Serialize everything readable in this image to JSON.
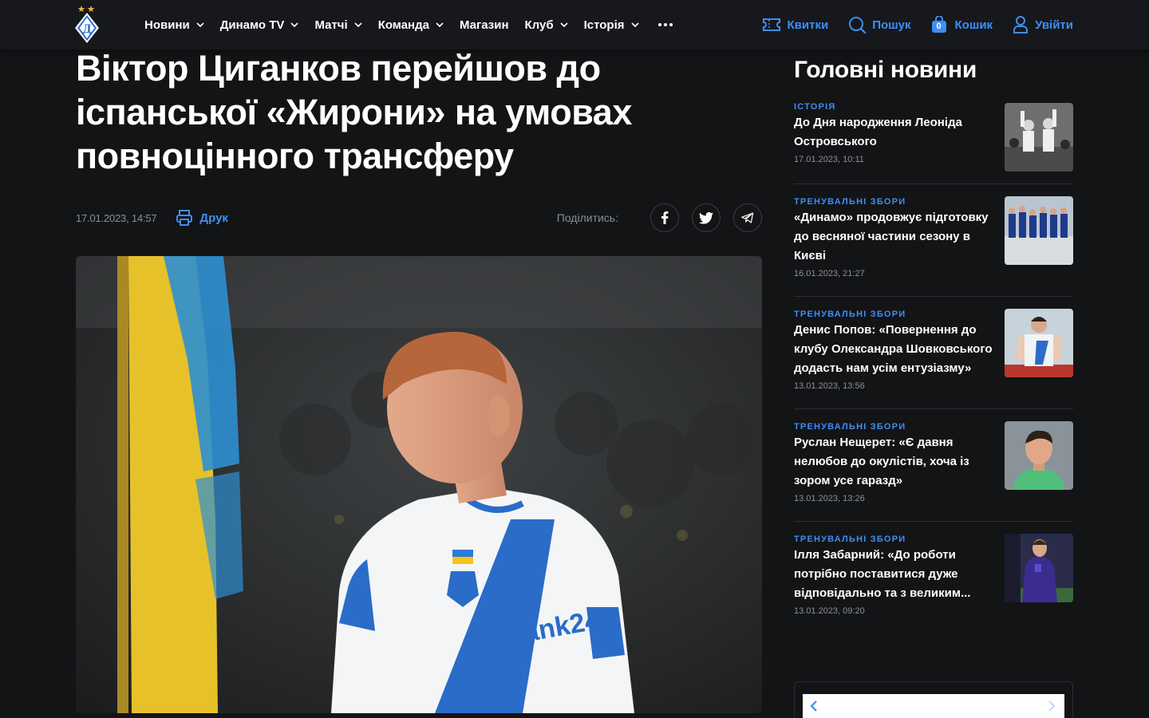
{
  "header": {
    "nav": [
      {
        "label": "Новини",
        "dropdown": true
      },
      {
        "label": "Динамо TV",
        "dropdown": true
      },
      {
        "label": "Матчі",
        "dropdown": true
      },
      {
        "label": "Команда",
        "dropdown": true
      },
      {
        "label": "Магазин",
        "dropdown": false
      },
      {
        "label": "Клуб",
        "dropdown": true
      },
      {
        "label": "Історія",
        "dropdown": true
      }
    ],
    "actions": {
      "tickets": "Квитки",
      "search": "Пошук",
      "cart": "Кошик",
      "cart_count": "0",
      "login": "Увійти"
    }
  },
  "article": {
    "title": "Віктор Циганков перейшов до іспанської «Жирони» на умовах повноцінного трансферу",
    "date": "17.01.2023, 14:57",
    "print_label": "Друк",
    "share_label": "Поділитись:",
    "share": [
      "facebook-icon",
      "twitter-icon",
      "telegram-icon"
    ]
  },
  "sidebar": {
    "title": "Головні новини",
    "news": [
      {
        "category": "Історія",
        "title": "До Дня народження Леоніда Островського",
        "date": "17.01.2023, 10:11"
      },
      {
        "category": "Тренувальні збори",
        "title": "«Динамо» продовжує підготовку до весняної частини сезону в Києві",
        "date": "16.01.2023, 21:27"
      },
      {
        "category": "Тренувальні збори",
        "title": "Денис Попов: «Повернення до клубу Олександра Шовковського додасть нам усім ентузіазму»",
        "date": "13.01.2023, 13:56"
      },
      {
        "category": "Тренувальні збори",
        "title": "Руслан Нещерет: «Є давня нелюбов до окулістів, хоча із зором усе гаразд»",
        "date": "13.01.2023, 13:26"
      },
      {
        "category": "Тренувальні збори",
        "title": "Ілля Забарний: «До роботи потрібно поставитися дуже відповідально та з великим...",
        "date": "13.01.2023, 09:20"
      }
    ]
  },
  "colors": {
    "accent": "#3d8ef5",
    "background": "#131416",
    "header": "#17181b"
  }
}
